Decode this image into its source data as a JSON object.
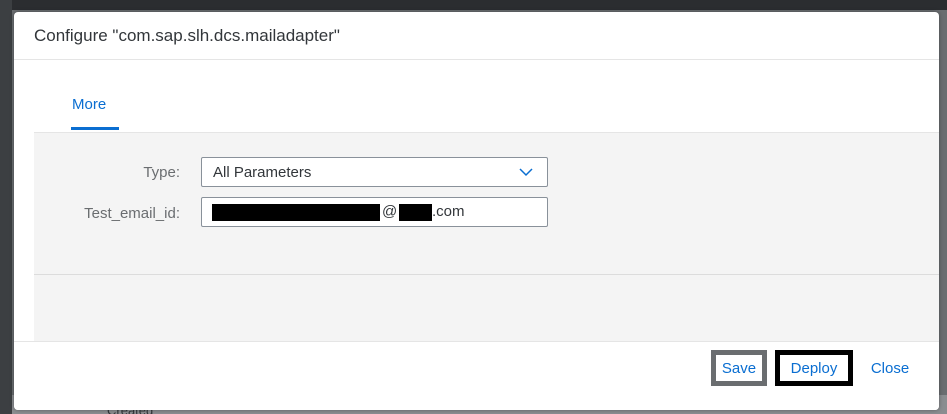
{
  "background": {
    "partial_text": "Created"
  },
  "dialog": {
    "title": "Configure \"com.sap.slh.dcs.mailadapter\"",
    "tabs": [
      {
        "label": "More",
        "selected": true
      }
    ],
    "form": {
      "type_label": "Type:",
      "type_value": "All Parameters",
      "email_label": "Test_email_id:",
      "email_value_visible_parts": {
        "at": "@",
        "suffix": ".com"
      }
    },
    "footer": {
      "save_label": "Save",
      "deploy_label": "Deploy",
      "close_label": "Close"
    }
  },
  "colors": {
    "accent": "#0a6ed1",
    "text": "#32363a",
    "label": "#6a6d70",
    "content_bg": "#f4f4f4"
  },
  "icons": {
    "select_arrow": "chevron-down-icon"
  }
}
